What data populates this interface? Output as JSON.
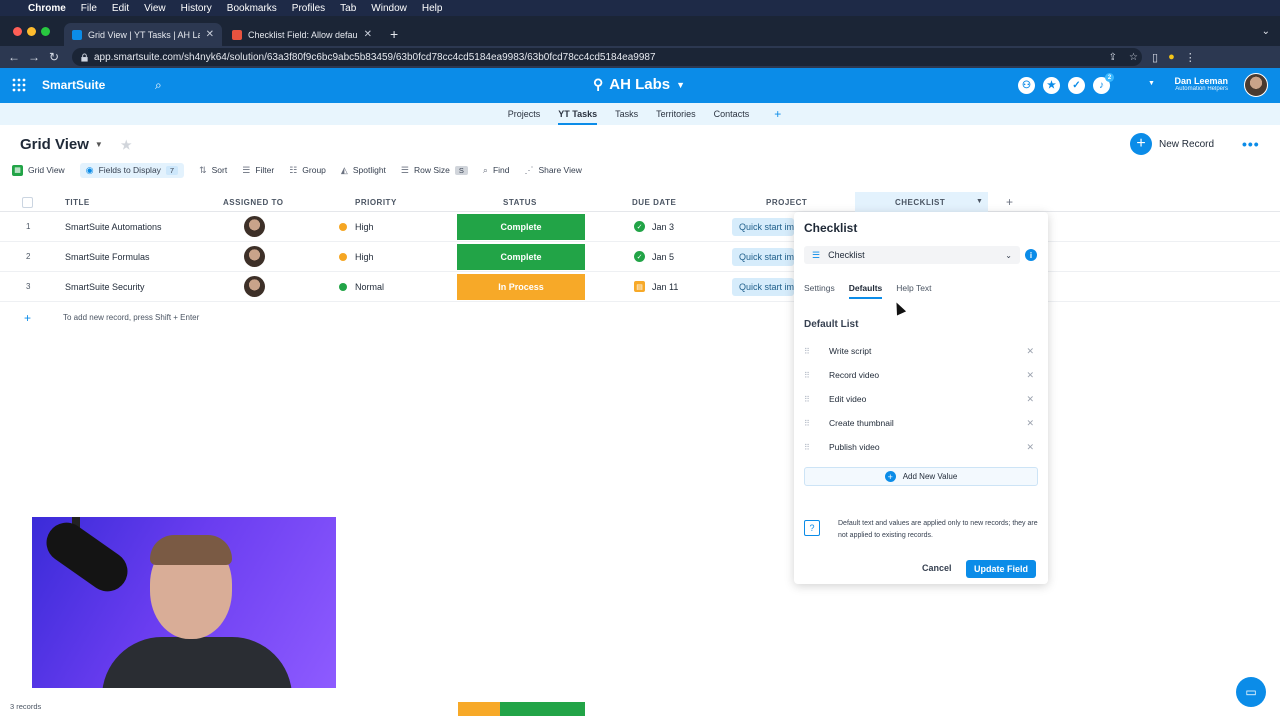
{
  "macos": {
    "menu": [
      "Chrome",
      "File",
      "Edit",
      "View",
      "History",
      "Bookmarks",
      "Profiles",
      "Tab",
      "Window",
      "Help"
    ]
  },
  "browser": {
    "tabs": [
      {
        "title": "Grid View | YT Tasks | AH Labs"
      },
      {
        "title": "Checklist Field: Allow default"
      }
    ],
    "url": "app.smartsuite.com/sh4nyk64/solution/63a3f80f9c6bc9abc5b83459/63b0fcd78cc4cd5184ea9983/63b0fcd78cc4cd5184ea9987"
  },
  "header": {
    "brand": "SmartSuite",
    "workspace": "AH Labs",
    "notification_count": "2",
    "user_name": "Dan Leeman",
    "user_org": "Automation Helpers"
  },
  "solution_nav": {
    "tabs": [
      "Projects",
      "YT Tasks",
      "Tasks",
      "Territories",
      "Contacts"
    ],
    "active": "YT Tasks"
  },
  "view": {
    "title": "Grid View",
    "new_record": "New Record",
    "toolbar": {
      "grid_view": "Grid View",
      "fields_to_display": "Fields to Display",
      "fields_count": "7",
      "sort": "Sort",
      "filter": "Filter",
      "group": "Group",
      "spotlight": "Spotlight",
      "row_size": "Row Size",
      "row_size_value": "S",
      "find": "Find",
      "share_view": "Share View"
    }
  },
  "grid": {
    "columns": [
      "TITLE",
      "ASSIGNED TO",
      "PRIORITY",
      "STATUS",
      "DUE DATE",
      "PROJECT",
      "CHECKLIST"
    ],
    "rows": [
      {
        "num": "1",
        "title": "SmartSuite Automations",
        "priority": "High",
        "status": "Complete",
        "due": "Jan 3",
        "project": "Quick start im"
      },
      {
        "num": "2",
        "title": "SmartSuite Formulas",
        "priority": "High",
        "status": "Complete",
        "due": "Jan 5",
        "project": "Quick start im"
      },
      {
        "num": "3",
        "title": "SmartSuite Security",
        "priority": "Normal",
        "status": "In Process",
        "due": "Jan 11",
        "project": "Quick start im"
      }
    ],
    "add_hint": "To add new record, press Shift + Enter"
  },
  "colors": {
    "accent": "#0b8ce8",
    "high": "#f5a623",
    "normal": "#22a447",
    "complete": "#22a447",
    "in_process": "#f7a928",
    "due_done": "#22a447",
    "due_pending": "#f7a928"
  },
  "panel": {
    "title": "Checklist",
    "field_type": "Checklist",
    "tabs": [
      "Settings",
      "Defaults",
      "Help Text"
    ],
    "active_tab": "Defaults",
    "default_list_label": "Default List",
    "items": [
      "Write script",
      "Record video",
      "Edit video",
      "Create thumbnail",
      "Publish video"
    ],
    "add_value": "Add New Value",
    "note": "Default text and values are applied only to new records; they are not applied to existing records.",
    "cancel": "Cancel",
    "update": "Update Field"
  },
  "footer": {
    "records": "3 records",
    "status_summary": [
      {
        "label": "In Process",
        "fraction": 0.333,
        "color": "#f7a928"
      },
      {
        "label": "Complete",
        "fraction": 0.667,
        "color": "#22a447"
      }
    ]
  }
}
